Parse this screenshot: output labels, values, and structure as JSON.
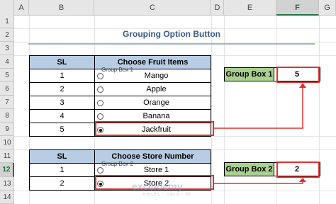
{
  "columns": [
    "A",
    "B",
    "C",
    "D",
    "E",
    "F",
    "G"
  ],
  "active_column": "F",
  "rows": [
    "1",
    "2",
    "3",
    "4",
    "5",
    "6",
    "7",
    "8",
    "9",
    "10",
    "11",
    "12",
    "13",
    "14"
  ],
  "active_row": "12",
  "title": "Grouping Option Button",
  "table1": {
    "headers": [
      "SL",
      "Choose Fruit Items"
    ],
    "group_label": "Group Box 1",
    "rows": [
      {
        "sl": "1",
        "item": "Mango",
        "selected": false
      },
      {
        "sl": "2",
        "item": "Apple",
        "selected": false
      },
      {
        "sl": "3",
        "item": "Orange",
        "selected": false
      },
      {
        "sl": "4",
        "item": "Banana",
        "selected": false
      },
      {
        "sl": "5",
        "item": "Jackfruit",
        "selected": true
      }
    ]
  },
  "table2": {
    "headers": [
      "SL",
      "Choose Store Number"
    ],
    "group_label": "Group Box 2",
    "rows": [
      {
        "sl": "1",
        "item": "Store 1",
        "selected": false
      },
      {
        "sl": "2",
        "item": "Store 2",
        "selected": true
      }
    ]
  },
  "group_box_1": {
    "label": "Group Box 1",
    "value": "5"
  },
  "group_box_2": {
    "label": "Group Box 2",
    "value": "2"
  },
  "watermark": {
    "name": "exceldemy",
    "tagline": "EXCEL · DATA · BI"
  },
  "colors": {
    "header_fill": "#b8cce4",
    "group_label_fill": "#a9d08e",
    "highlight": "#e0312e",
    "title_color": "#3a5a88"
  }
}
